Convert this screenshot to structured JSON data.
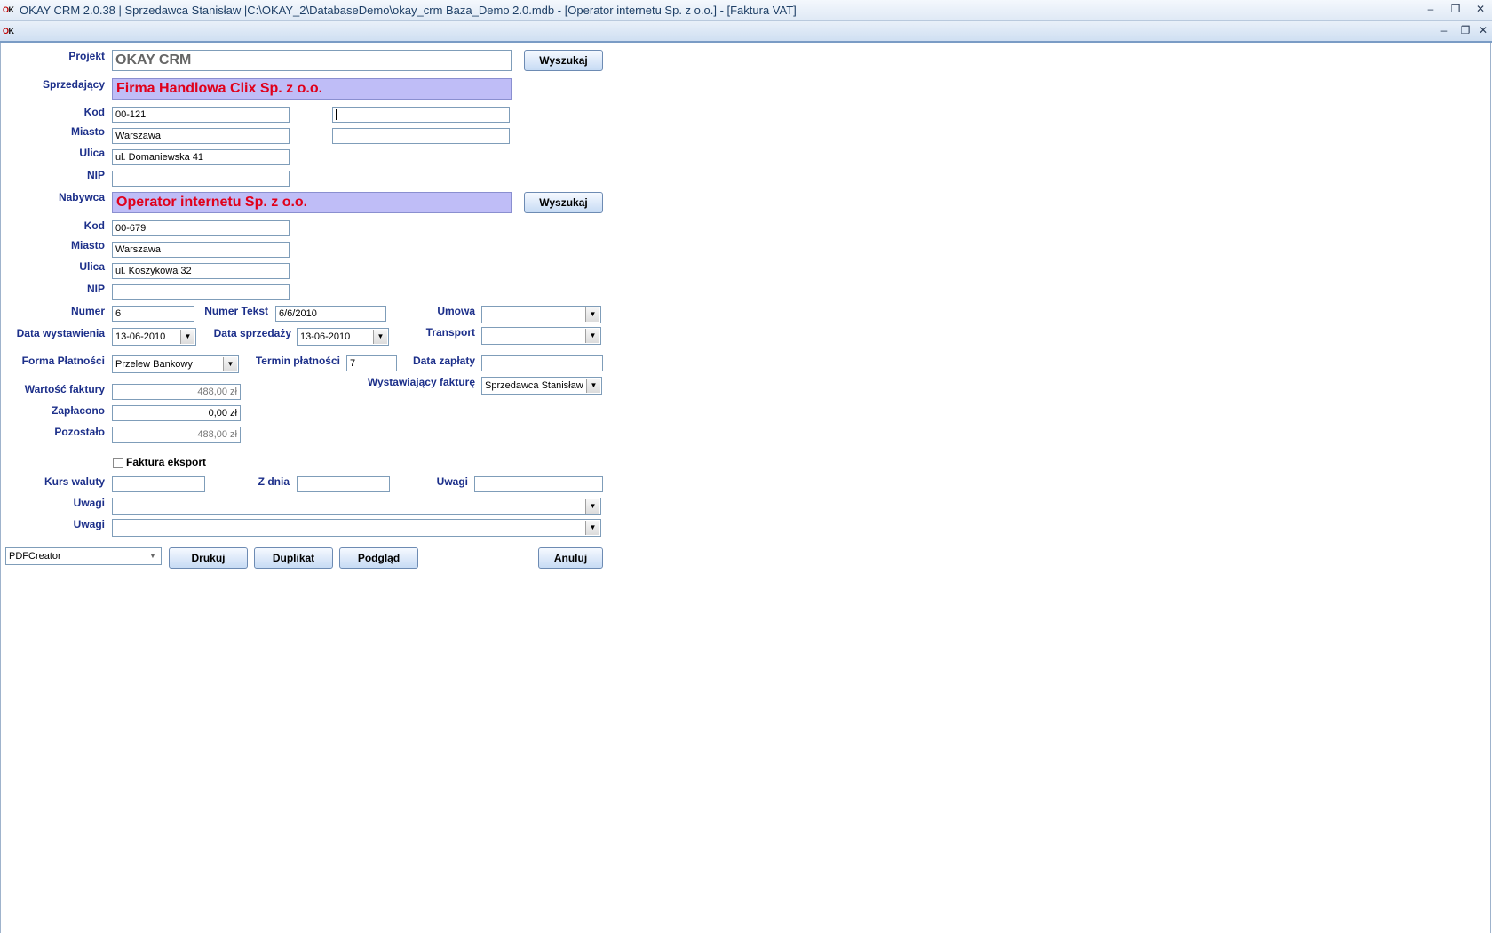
{
  "window": {
    "title": "OKAY CRM 2.0.38 | Sprzedawca Stanisław |C:\\OKAY_2\\DatabaseDemo\\okay_crm Baza_Demo 2.0.mdb - [Operator internetu Sp. z o.o.] - [Faktura VAT]",
    "logo_o": "O",
    "logo_k": "K",
    "minimize": "–",
    "restore": "❐",
    "close": "✕"
  },
  "labels": {
    "projekt": "Projekt",
    "sprzedajacy": "Sprzedający",
    "kod": "Kod",
    "miasto": "Miasto",
    "ulica": "Ulica",
    "nip": "NIP",
    "nabywca": "Nabywca",
    "numer": "Numer",
    "numer_tekst": "Numer Tekst",
    "umowa": "Umowa",
    "data_wystawienia": "Data wystawienia",
    "data_sprzedazy": "Data sprzedaży",
    "transport": "Transport",
    "forma_platnosci": "Forma Płatności",
    "termin_platnosci": "Termin płatności",
    "data_zaplaty": "Data zapłaty",
    "wystawiajacy": "Wystawiający fakturę",
    "wartosc_faktury": "Wartość faktury",
    "zaplacono": "Zapłacono",
    "pozostalo": "Pozostało",
    "faktura_eksport": "Faktura eksport",
    "kurs_waluty": "Kurs waluty",
    "z_dnia": "Z dnia",
    "uwagi": "Uwagi"
  },
  "values": {
    "projekt": "OKAY CRM",
    "sprzedajacy": "Firma Handlowa Clix Sp. z o.o.",
    "s_kod": "00-121",
    "s_miasto": "Warszawa",
    "s_ulica": "ul. Domaniewska 41",
    "s_nip": "",
    "nabywca": "Operator internetu Sp. z o.o.",
    "n_kod": "00-679",
    "n_miasto": "Warszawa",
    "n_ulica": "ul. Koszykowa 32",
    "n_nip": "",
    "numer": "6",
    "numer_tekst": "6/6/2010",
    "umowa": "",
    "data_wystawienia": "13-06-2010",
    "data_sprzedazy": "13-06-2010",
    "transport": "",
    "forma_platnosci": "Przelew Bankowy",
    "termin_platnosci": "7",
    "data_zaplaty": "",
    "wystawiajacy": "Sprzedawca Stanisław",
    "wartosc_faktury": "488,00 zł",
    "zaplacono": "0,00 zł",
    "pozostalo": "488,00 zł",
    "kurs_waluty": "",
    "z_dnia": "",
    "uwagi_short": "",
    "uwagi_1": "",
    "uwagi_2": "",
    "printer": "PDFCreator"
  },
  "buttons": {
    "wyszukaj": "Wyszukaj",
    "drukuj": "Drukuj",
    "duplikat": "Duplikat",
    "podglad": "Podgląd",
    "anuluj": "Anuluj"
  },
  "icons": {
    "dropdown": "▼"
  }
}
